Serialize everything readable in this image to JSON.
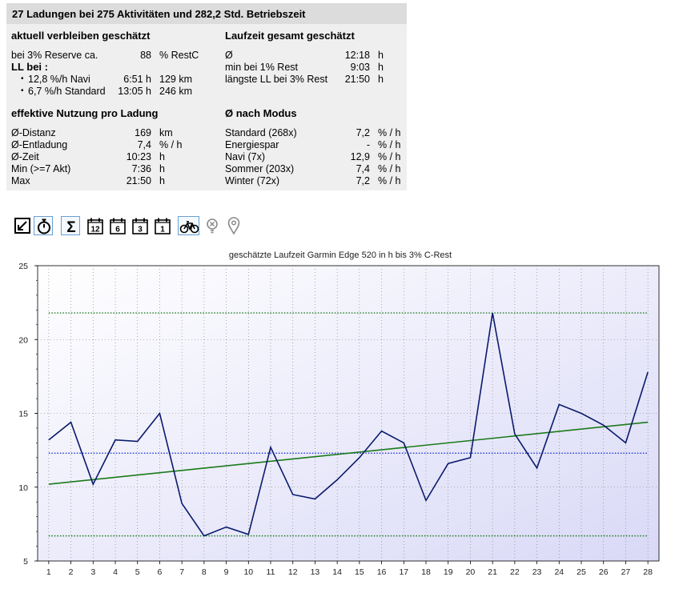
{
  "header": {
    "title": "27 Ladungen bei 275 Aktivitäten und 282,2 Std. Betriebszeit"
  },
  "left_top": {
    "heading": "aktuell verbleiben geschätzt",
    "reserve_label": "bei 3% Reserve ca.",
    "reserve_value": "88",
    "reserve_unit": "% RestC",
    "ll_label": "LL bei :",
    "rows": [
      {
        "label": "12,8 %/h Navi",
        "time": "6:51 h",
        "dist": "129 km"
      },
      {
        "label": "6,7 %/h Standard",
        "time": "13:05 h",
        "dist": "246 km"
      }
    ]
  },
  "right_top": {
    "heading": "Laufzeit gesamt geschätzt",
    "rows": [
      {
        "label": "Ø",
        "value": "12:18",
        "unit": "h"
      },
      {
        "label": "min bei 1% Rest",
        "value": "9:03",
        "unit": "h"
      },
      {
        "label": "längste LL bei 3% Rest",
        "value": "21:50",
        "unit": "h"
      }
    ]
  },
  "left_bottom": {
    "heading": "effektive Nutzung pro Ladung",
    "rows": [
      {
        "label": "Ø-Distanz",
        "value": "169",
        "unit": "km"
      },
      {
        "label": "Ø-Entladung",
        "value": "7,4",
        "unit": "% / h"
      },
      {
        "label": "Ø-Zeit",
        "value": "10:23",
        "unit": "h"
      },
      {
        "label": "Min (>=7 Akt)",
        "value": "7:36",
        "unit": "h"
      },
      {
        "label": "Max",
        "value": "21:50",
        "unit": "h"
      }
    ]
  },
  "right_bottom": {
    "heading": "Ø nach Modus",
    "rows": [
      {
        "label": "Standard (268x)",
        "value": "7,2",
        "unit": "% / h"
      },
      {
        "label": "Energiespar",
        "value": "-",
        "unit": "% / h"
      },
      {
        "label": "Navi (7x)",
        "value": "12,9",
        "unit": "% / h"
      },
      {
        "label": "Sommer (203x)",
        "value": "7,4",
        "unit": "% / h"
      },
      {
        "label": "Winter (72x)",
        "value": "7,2",
        "unit": "% / h"
      }
    ]
  },
  "toolbar": {
    "items": [
      {
        "icon": "export-icon",
        "label": ""
      },
      {
        "icon": "stopwatch-icon",
        "label": ""
      },
      {
        "icon": "sigma-icon",
        "label": "Σ"
      },
      {
        "icon": "calendar-icon",
        "label": "12"
      },
      {
        "icon": "calendar-icon",
        "label": "6"
      },
      {
        "icon": "calendar-icon",
        "label": "3"
      },
      {
        "icon": "calendar-icon",
        "label": "1"
      },
      {
        "icon": "bicycle-icon",
        "label": ""
      },
      {
        "icon": "bulb-off-icon",
        "label": ""
      },
      {
        "icon": "map-pin-icon",
        "label": ""
      }
    ]
  },
  "colors": {
    "series": "#0a1a6b",
    "trend": "#1a7a1a",
    "mean": "#2030d0",
    "minmax": "#1a7a1a",
    "selected_border": "#6aa0d0"
  },
  "chart_data": {
    "type": "line",
    "title": "geschätzte Laufzeit Garmin Edge 520 in h bis 3% C-Rest",
    "xlabel": "",
    "ylabel": "",
    "x": [
      1,
      2,
      3,
      4,
      5,
      6,
      7,
      8,
      9,
      10,
      11,
      12,
      13,
      14,
      15,
      16,
      17,
      18,
      19,
      20,
      21,
      22,
      23,
      24,
      25,
      26,
      27,
      28
    ],
    "xlim": [
      0.5,
      28.5
    ],
    "ylim": [
      5,
      25
    ],
    "yticks": [
      5,
      10,
      15,
      20,
      25
    ],
    "grid": true,
    "series": [
      {
        "values": [
          13.2,
          14.4,
          10.2,
          13.2,
          13.1,
          15.0,
          8.9,
          6.7,
          7.3,
          6.8,
          12.7,
          9.5,
          9.2,
          10.5,
          12.0,
          13.8,
          13.0,
          9.1,
          11.6,
          12.0,
          21.8,
          13.6,
          11.3,
          15.6,
          15.0,
          14.2,
          13.0,
          17.8
        ]
      }
    ],
    "trend": {
      "start": 10.2,
      "end": 14.4
    },
    "mean": 12.3,
    "min_line": 6.7,
    "max_line": 21.8
  }
}
